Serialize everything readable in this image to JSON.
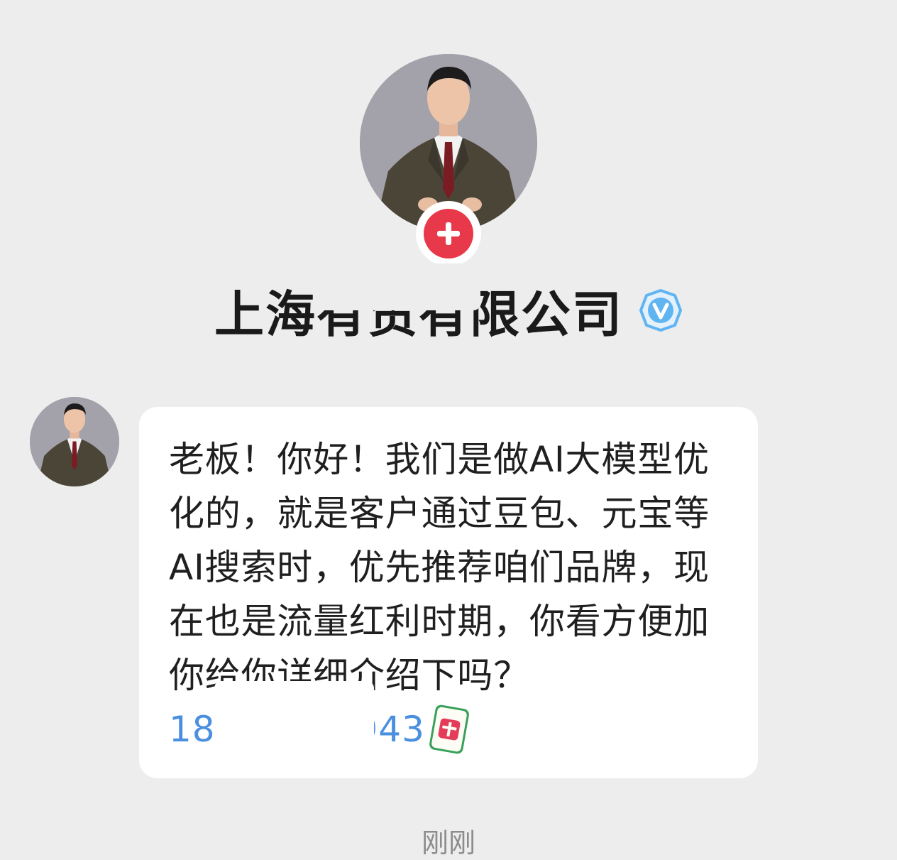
{
  "profile": {
    "company_name": "上海有贸有限公司",
    "avatar_icon": "person-in-suit-avatar",
    "follow_icon": "plus-icon",
    "verified_icon": "verified-v-badge-icon",
    "follow_color": "#e8394a",
    "verified_color": "#60b4f2"
  },
  "message": {
    "text": "老板！你好！我们是做AI大模型优化的，就是客户通过豆包、元宝等AI搜索时，优先推荐咱们品牌，现在也是流量红利时期，你看方便加你给你详细介绍下吗？",
    "phone": "18791132943",
    "emoji_icon": "mahjong-fa-tile-emoji",
    "link_color": "#4a8fe0"
  },
  "timestamp": "刚刚"
}
